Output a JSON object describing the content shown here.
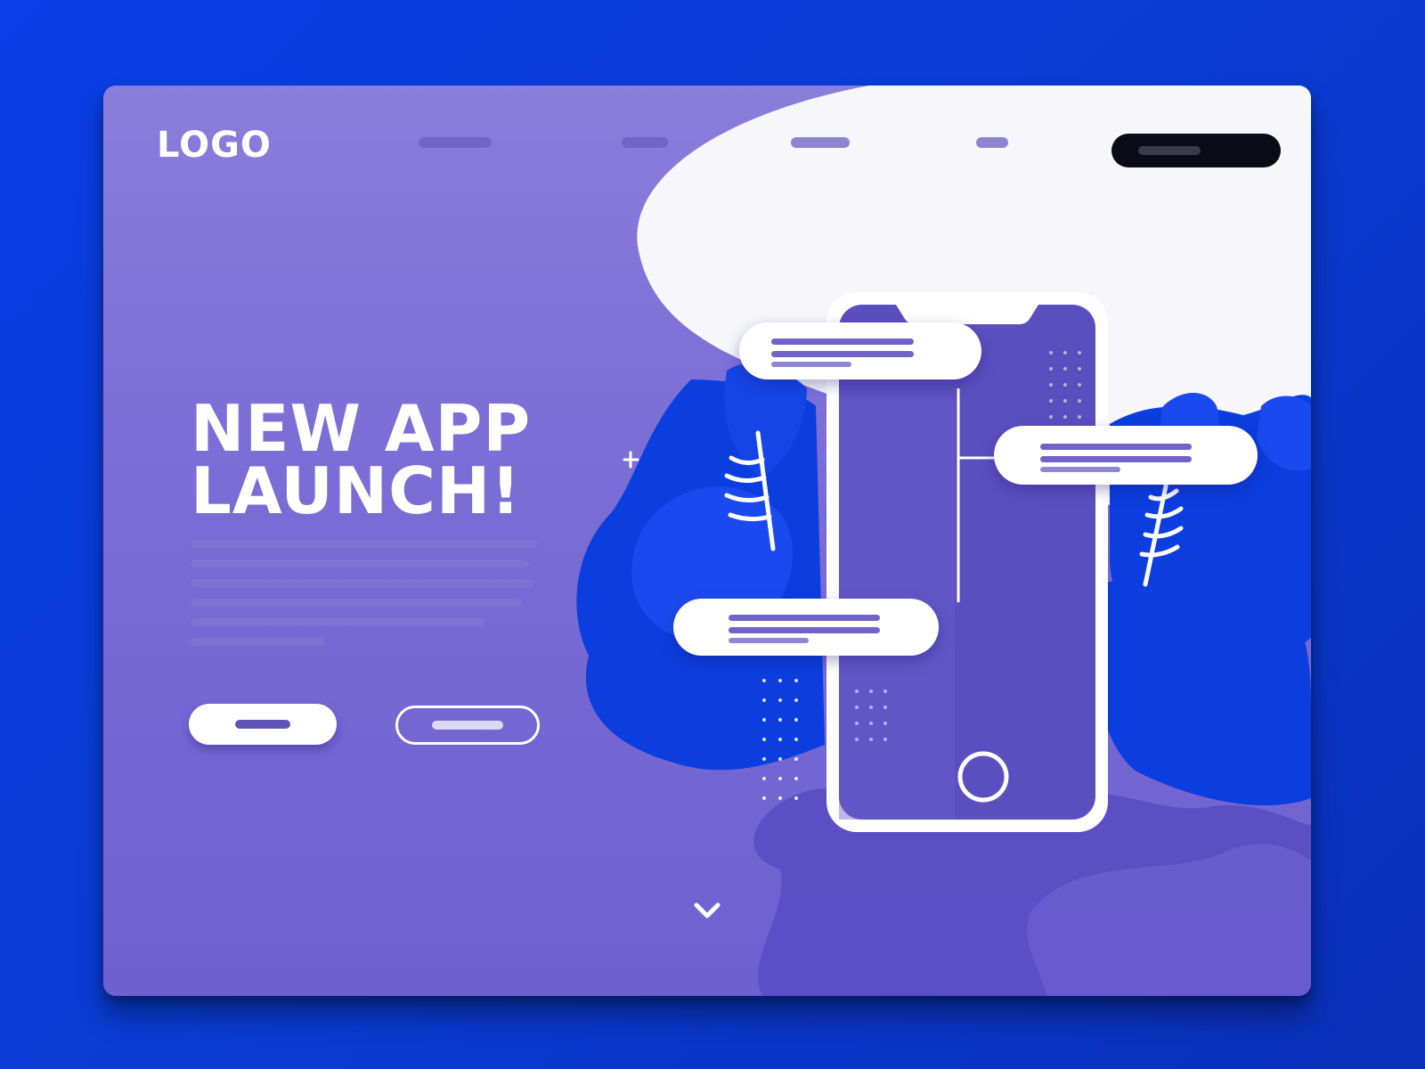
{
  "logo": {
    "text": "LOGO"
  },
  "nav": {
    "items": [
      {
        "label": ""
      },
      {
        "label": ""
      },
      {
        "label": ""
      },
      {
        "label": ""
      }
    ],
    "signin_label": ""
  },
  "hero": {
    "title_line1": "NEW APP",
    "title_line2": "LAUNCH!",
    "primary_button": "",
    "secondary_button": ""
  },
  "icons": {
    "scroll": "chevron-down-icon",
    "phone_home": "home-button-icon"
  },
  "colors": {
    "background": "#0a3ce0",
    "card_purple": "#7c6fd6",
    "accent_blue": "#0b3ddf",
    "phone_screen": "#5b4fc0",
    "white": "#ffffff",
    "dark_pill": "#0b0b18"
  }
}
